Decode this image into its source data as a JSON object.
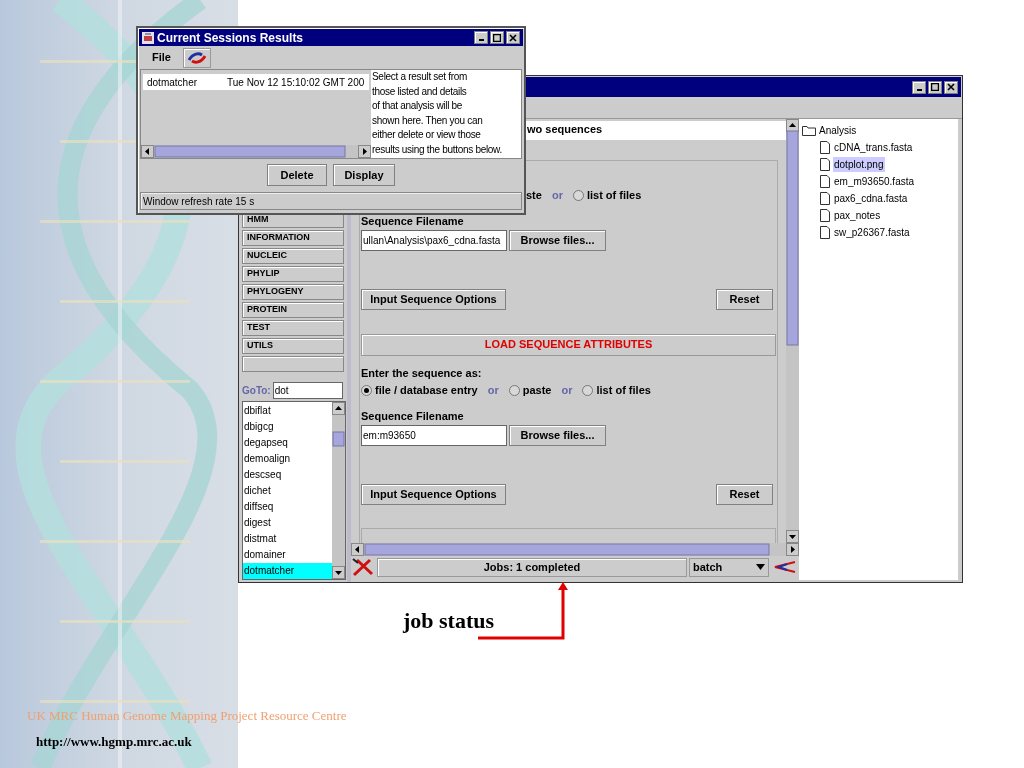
{
  "sessions_window": {
    "title": "Current Sessions Results",
    "menu": [
      "File"
    ],
    "results": [
      {
        "name": "dotmatcher",
        "date": "Tue Nov 12 15:10:02 GMT 200"
      }
    ],
    "help_lines": [
      "Select a result set from",
      "those listed and details",
      "of that analysis will be",
      "shown here. Then you can",
      "either delete or view those",
      "results using the buttons below."
    ],
    "buttons": [
      "Delete",
      "Display"
    ],
    "status": "Window refresh rate 15 s"
  },
  "main_window": {
    "program_groups": [
      "HMM",
      "INFORMATION",
      "NUCLEIC",
      "PHYLIP",
      "PHYLOGENY",
      "PROTEIN",
      "TEST",
      "UTILS"
    ],
    "goto": {
      "label": "GoTo:",
      "value": "dot"
    },
    "programs": [
      {
        "label": "dbiflat",
        "selected": false
      },
      {
        "label": "dbigcg",
        "selected": false
      },
      {
        "label": "degapseq",
        "selected": false
      },
      {
        "label": "demoalign",
        "selected": false
      },
      {
        "label": "descseq",
        "selected": false
      },
      {
        "label": "dichet",
        "selected": false
      },
      {
        "label": "diffseq",
        "selected": false
      },
      {
        "label": "digest",
        "selected": false
      },
      {
        "label": "distmat",
        "selected": false
      },
      {
        "label": "domainer",
        "selected": false
      },
      {
        "label": "dotmatcher",
        "selected": true
      }
    ],
    "header": "wo sequences",
    "sections": [
      {
        "options": [
          {
            "kind": "fragment",
            "label": "ste"
          },
          {
            "kind": "separator",
            "label": "or"
          },
          {
            "kind": "radio",
            "label": "list of files",
            "selected": false
          }
        ],
        "filename_label": "Sequence Filename",
        "filename": "ullan\\Analysis\\pax6_cdna.fasta",
        "browse": "Browse files...",
        "options_button": "Input Sequence Options",
        "reset": "Reset"
      },
      {
        "title": "LOAD SEQUENCE ATTRIBUTES",
        "prompt": "Enter the sequence as:",
        "options": [
          {
            "kind": "radio",
            "label": "file / database entry",
            "selected": true
          },
          {
            "kind": "separator",
            "label": "or"
          },
          {
            "kind": "radio",
            "label": "paste",
            "selected": false
          },
          {
            "kind": "separator",
            "label": "or"
          },
          {
            "kind": "radio",
            "label": "list of files",
            "selected": false
          }
        ],
        "filename_label": "Sequence Filename",
        "filename": "em:m93650",
        "browse": "Browse files...",
        "options_button": "Input Sequence Options",
        "reset": "Reset"
      }
    ],
    "status": {
      "jobs": "Jobs: 1 completed",
      "mode": "batch"
    },
    "file_tree": {
      "label": "Analysis",
      "children": [
        {
          "label": "cDNA_trans.fasta",
          "selected": false
        },
        {
          "label": "dotplot.png",
          "selected": true
        },
        {
          "label": "em_m93650.fasta",
          "selected": false
        },
        {
          "label": "pax6_cdna.fasta",
          "selected": false
        },
        {
          "label": "pax_notes",
          "selected": false
        },
        {
          "label": "sw_p26367.fasta",
          "selected": false
        }
      ]
    }
  },
  "annotation": {
    "label": "job status"
  },
  "footer": {
    "organization": "UK MRC Human Genome Mapping Project Resource Centre",
    "url": "http://www.hgmp.mrc.ac.uk"
  }
}
